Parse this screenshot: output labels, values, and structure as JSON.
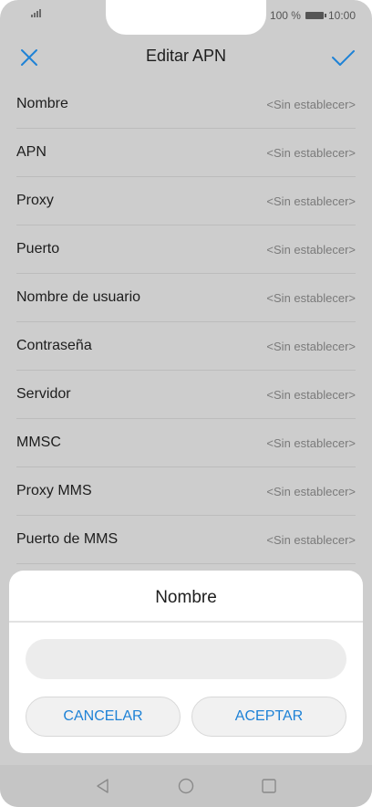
{
  "status": {
    "battery_text": "100 %",
    "time": "10:00"
  },
  "header": {
    "title": "Editar APN"
  },
  "rows": [
    {
      "label": "Nombre",
      "value": "<Sin establecer>"
    },
    {
      "label": "APN",
      "value": "<Sin establecer>"
    },
    {
      "label": "Proxy",
      "value": "<Sin establecer>"
    },
    {
      "label": "Puerto",
      "value": "<Sin establecer>"
    },
    {
      "label": "Nombre de usuario",
      "value": "<Sin establecer>"
    },
    {
      "label": "Contraseña",
      "value": "<Sin establecer>"
    },
    {
      "label": "Servidor",
      "value": "<Sin establecer>"
    },
    {
      "label": "MMSC",
      "value": "<Sin establecer>"
    },
    {
      "label": "Proxy MMS",
      "value": "<Sin establecer>"
    },
    {
      "label": "Puerto de MMS",
      "value": "<Sin establecer>"
    }
  ],
  "dialog": {
    "title": "Nombre",
    "input_value": "",
    "cancel_label": "CANCELAR",
    "accept_label": "ACEPTAR"
  },
  "colors": {
    "accent": "#1e82d6",
    "overlay_bg": "#cdcdcd"
  },
  "icons": {
    "header_left": "close-icon",
    "header_right": "check-icon",
    "nav": [
      "back-triangle-icon",
      "home-circle-icon",
      "recents-square-icon"
    ]
  }
}
